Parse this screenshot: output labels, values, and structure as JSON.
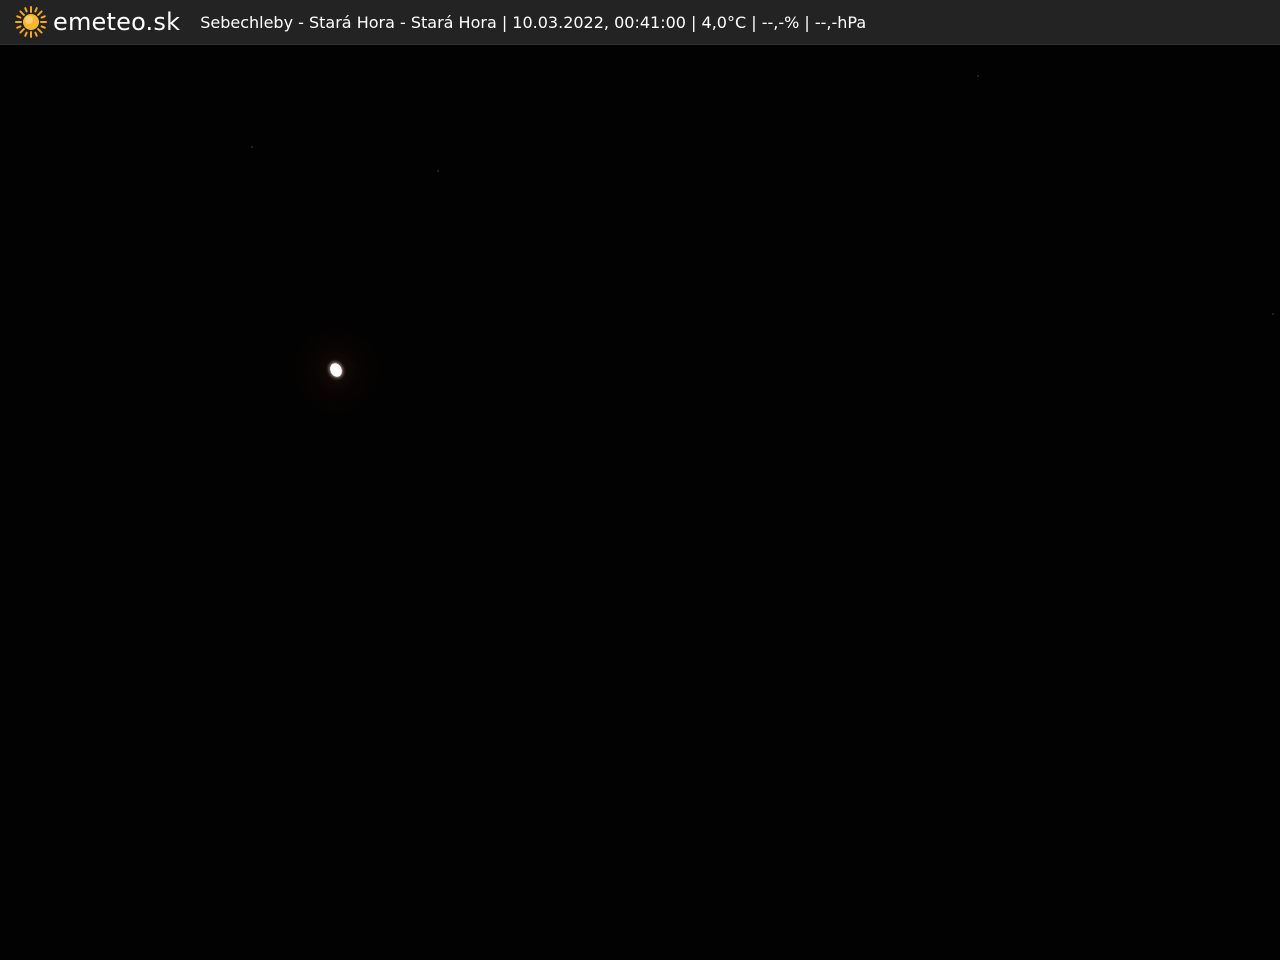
{
  "header": {
    "logo_text": "emeteo.sk",
    "logo_icon": "sun-icon",
    "info": "Sebechleby - Stará Hora - Stará Hora | 10.03.2022, 00:41:00 | 4,0°C | --,-% | --,-hPa"
  },
  "scene": {
    "description_icon": "moon-icon"
  },
  "colors": {
    "header_bg": "#232323",
    "sun": "#f5a623",
    "background": "#020202"
  }
}
